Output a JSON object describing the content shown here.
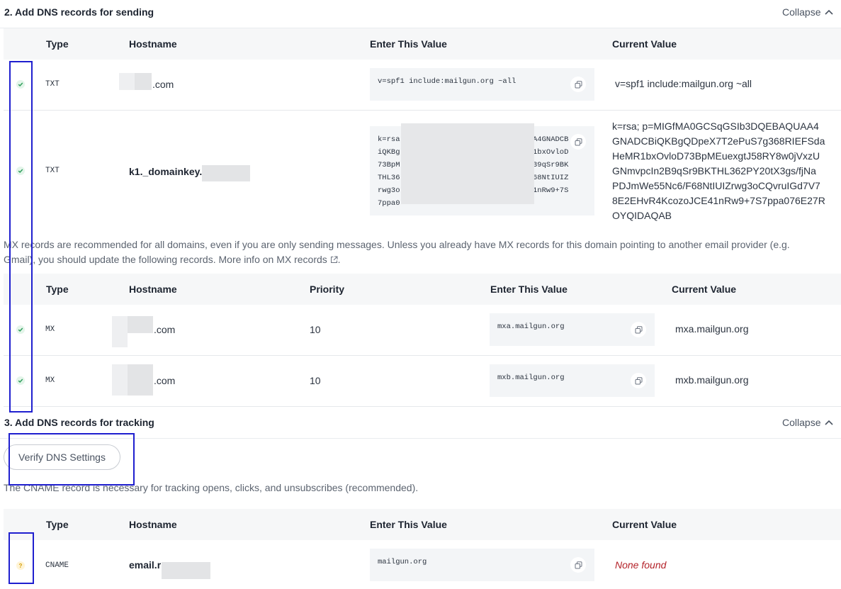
{
  "section2": {
    "title": "2. Add DNS records for sending",
    "collapse": "Collapse"
  },
  "table1": {
    "headers": {
      "type": "Type",
      "hostname": "Hostname",
      "value": "Enter This Value",
      "current": "Current Value"
    },
    "rows": [
      {
        "type": "TXT",
        "hostname": ".com",
        "value": "v=spf1 include:mailgun.org ~all",
        "current": "v=spf1 include:mailgun.org ~all"
      },
      {
        "type": "TXT",
        "hostname": "k1._domainkey.",
        "value_lines": [
          "k=rsa",
          "iQKBg",
          "73BpM",
          "THL36",
          "rwg3o",
          "7ppa0"
        ],
        "value_tail": [
          "A4GNADCB",
          "1bxOvloD",
          "39qSr9BK",
          "68NtIUIZ",
          "1nRw9+7S",
          ""
        ],
        "current_lines": [
          "k=rsa; p=MIGfMA0GCSqGSIb3DQEBAQUAA4",
          "GNADCBiQKBgQDpeX7T2ePuS7g368RIEFSda",
          "HeMR1bxOvloD73BpMEuexgtJ58RY8w0jVxzU",
          "GNmvpcIn2B9qSr9BKTHL362PY20tX3gs/fjNa",
          "PDJmWe55Nc6/F68NtIUIZrwg3oCQvruIGd7V7",
          "8E2EHvR4KcozoJCE41nRw9+7S7ppa076E27R",
          "OYQIDAQAB"
        ]
      }
    ]
  },
  "mx_note": {
    "line1": "MX records are recommended for all domains, even if you are only sending messages. Unless you already have MX records for this domain pointing to another email provider (e.g.",
    "line2": "Gmail), you should update the following records. More info on MX records"
  },
  "table2": {
    "headers": {
      "type": "Type",
      "hostname": "Hostname",
      "priority": "Priority",
      "value": "Enter This Value",
      "current": "Current Value"
    },
    "rows": [
      {
        "type": "MX",
        "hostname": ".com",
        "priority": "10",
        "value": "mxa.mailgun.org",
        "current": "mxa.mailgun.org"
      },
      {
        "type": "MX",
        "hostname": ".com",
        "priority": "10",
        "value": "mxb.mailgun.org",
        "current": "mxb.mailgun.org"
      }
    ]
  },
  "section3": {
    "title": "3. Add DNS records for tracking",
    "collapse": "Collapse"
  },
  "verify_button": "Verify DNS Settings",
  "cname_note": "The CNAME record is necessary for tracking opens, clicks, and unsubscribes (recommended).",
  "table3": {
    "headers": {
      "type": "Type",
      "hostname": "Hostname",
      "value": "Enter This Value",
      "current": "Current Value"
    },
    "rows": [
      {
        "type": "CNAME",
        "hostname": "email.r",
        "value": "mailgun.org",
        "current": "None found"
      }
    ]
  },
  "colors": {
    "highlight": "#1f1fcf",
    "check": "#2e9e5b",
    "warning": "#d39a00",
    "error": "#b4232a"
  },
  "icons": {
    "check": "check-icon",
    "question": "question-icon",
    "copy": "copy-icon",
    "chevron": "chevron-up-icon",
    "external": "external-link-icon"
  }
}
